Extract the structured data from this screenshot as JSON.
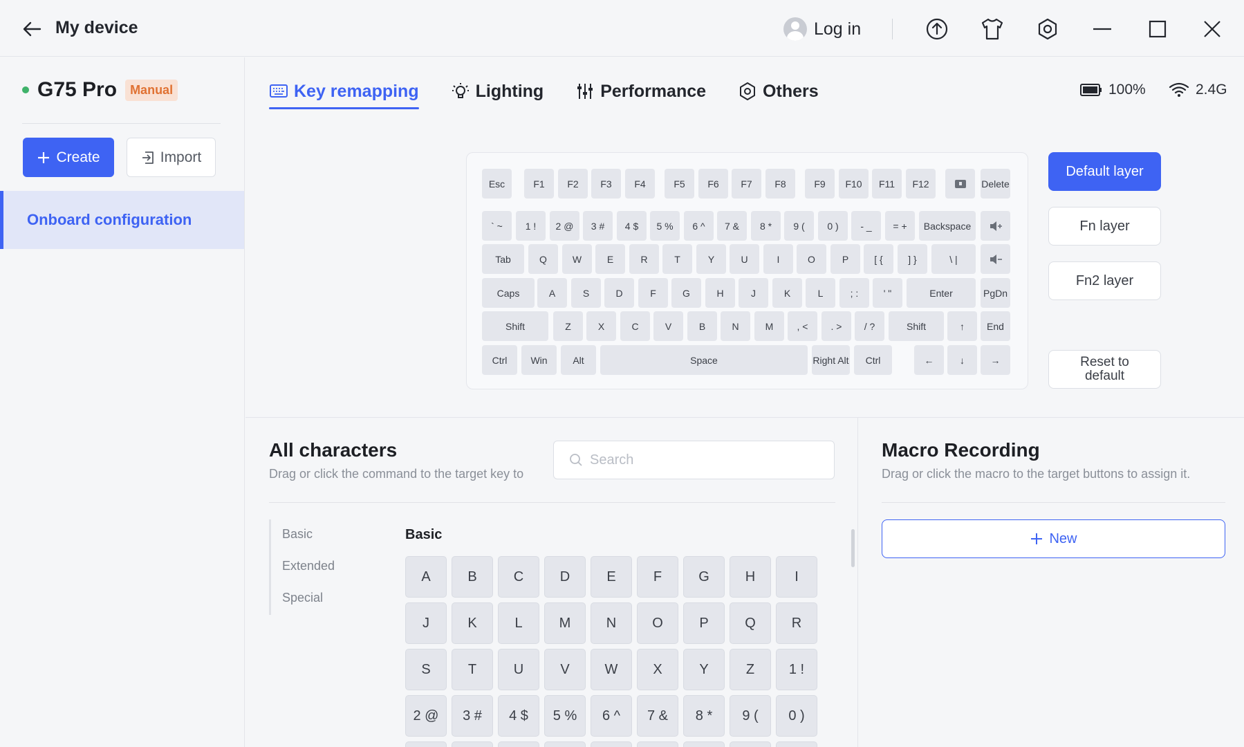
{
  "titlebar": {
    "title": "My device",
    "login_label": "Log in",
    "icons": [
      "back-arrow-icon",
      "user-avatar-icon",
      "upload-icon",
      "tshirt-icon",
      "settings-hex-icon",
      "minimize-icon",
      "maximize-icon",
      "close-icon"
    ]
  },
  "sidebar": {
    "device_name": "G75 Pro",
    "mode_badge": "Manual",
    "create_label": "Create",
    "import_label": "Import",
    "item_label": "Onboard configuration",
    "status_color": "#3fb26a"
  },
  "tabs": [
    {
      "label": "Key remapping",
      "icon": "keyboard-icon",
      "active": true
    },
    {
      "label": "Lighting",
      "icon": "bulb-icon",
      "active": false
    },
    {
      "label": "Performance",
      "icon": "sliders-icon",
      "active": false
    },
    {
      "label": "Others",
      "icon": "hex-settings-icon",
      "active": false
    }
  ],
  "status": {
    "battery": "100%",
    "connection": "2.4G"
  },
  "keyboard": {
    "row1": [
      "Esc",
      "F1",
      "F2",
      "F3",
      "F4",
      "F5",
      "F6",
      "F7",
      "F8",
      "F9",
      "F10",
      "F11",
      "F12",
      "",
      "Delete"
    ],
    "row2": [
      "` ~",
      "1 !",
      "2 @",
      "3 #",
      "4 $",
      "5 %",
      "6 ^",
      "7 &",
      "8 *",
      "9 (",
      "0 )",
      "- _",
      "= +",
      "Backspace",
      ""
    ],
    "row3": [
      "Tab",
      "Q",
      "W",
      "E",
      "R",
      "T",
      "Y",
      "U",
      "I",
      "O",
      "P",
      "[ {",
      "] }",
      "\\ |",
      ""
    ],
    "row4": [
      "Caps",
      "A",
      "S",
      "D",
      "F",
      "G",
      "H",
      "J",
      "K",
      "L",
      "; :",
      "' \"",
      "Enter",
      "PgDn"
    ],
    "row5": [
      "Shift",
      "Z",
      "X",
      "C",
      "V",
      "B",
      "N",
      "M",
      ", <",
      ". >",
      "/ ?",
      "Shift",
      "↑",
      "End"
    ],
    "row6": [
      "Ctrl",
      "Win",
      "Alt",
      "Space",
      "Right Alt",
      "Ctrl",
      "←",
      "↓",
      "→"
    ]
  },
  "layers": {
    "default": "Default layer",
    "fn": "Fn layer",
    "fn2": "Fn2 layer",
    "reset": "Reset to default"
  },
  "characters": {
    "title": "All characters",
    "subtitle": "Drag or click the command to the target key to",
    "search_placeholder": "Search",
    "categories": [
      "Basic",
      "Extended",
      "Special"
    ],
    "section_title": "Basic",
    "keys": [
      "A",
      "B",
      "C",
      "D",
      "E",
      "F",
      "G",
      "H",
      "I",
      "J",
      "K",
      "L",
      "M",
      "N",
      "O",
      "P",
      "Q",
      "R",
      "S",
      "T",
      "U",
      "V",
      "W",
      "X",
      "Y",
      "Z",
      "1 !",
      "2 @",
      "3 #",
      "4 $",
      "5 %",
      "6 ^",
      "7 &",
      "8 *",
      "9 (",
      "0 )"
    ]
  },
  "macro": {
    "title": "Macro Recording",
    "subtitle": "Drag or click the macro to the target buttons to assign it.",
    "new_label": "New"
  },
  "colors": {
    "accent": "#3e63f3",
    "badge_bg": "#f9e1d4",
    "badge_text": "#e07233"
  }
}
